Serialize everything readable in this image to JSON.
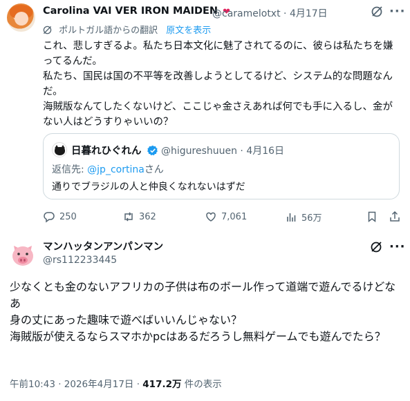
{
  "tweet1": {
    "display_name": "Carolina VAI VER IRON MAIDEN",
    "handle": "@caramelotxt",
    "date": "4月17日",
    "translated_from": "ポルトガル語からの翻訳",
    "show_original": "原文を表示",
    "body_paragraphs": [
      "これ、悲しすぎるよ。私たち日本文化に魅了されてるのに、彼らは私たちを嫌ってるんだ。",
      "私たち、国民は国の不平等を改善しようとしてるけど、システム的な問題なんだ。",
      "海賊版なんてしたくないけど、ここじゃ金さえあれば何でも手に入るし、金がない人はどうすりゃいいの？"
    ],
    "quote": {
      "display_name": "日暮れひぐれん",
      "handle_date": "@higureshuuen · 4月16日",
      "reply_prefix": "返信先: ",
      "reply_handle": "@jp_cortina",
      "reply_suffix": "さん",
      "text": "通りでブラジルの人と仲良くなれないはずだ"
    },
    "actions": {
      "replies": "250",
      "retweets": "362",
      "likes": "7,061",
      "views": "56万"
    }
  },
  "tweet2": {
    "display_name": "マンハッタンアンパンマン",
    "handle": "@rs112233445",
    "body_paragraphs": [
      "少なくとも金のないアフリカの子供は布のボール作って道端で遊んでるけどなあ",
      "身の丈にあった趣味で遊べばいいんじゃない？",
      "海賊版が使えるならスマホかpcはあるだろうし無料ゲームでも遊んでたら？"
    ],
    "time": "午前10:43 · 2026年4月17日 · ",
    "views_count": "417.2万",
    "views_label": " 件の表示"
  },
  "colors": {
    "accent": "#1d9bf0",
    "muted": "#536471",
    "text": "#0f1419",
    "border": "#cfd9de"
  }
}
